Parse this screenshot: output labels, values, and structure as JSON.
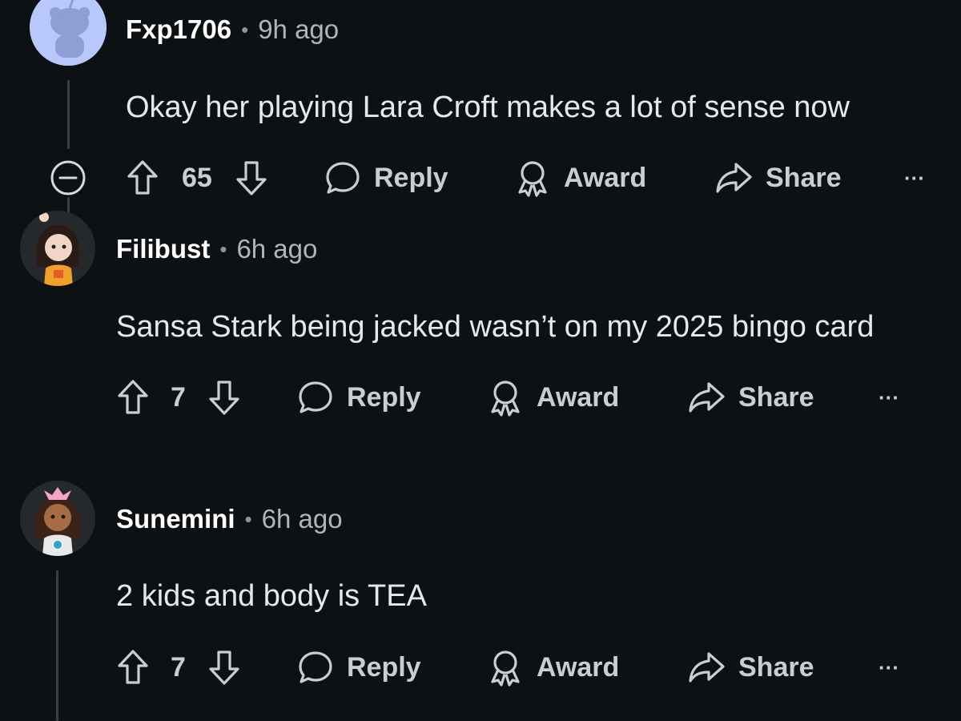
{
  "comments": [
    {
      "username": "Fxp1706",
      "separator": "•",
      "time": "9h ago",
      "body": "Okay her playing Lara Croft makes a lot of sense now",
      "votes": "65",
      "reply": "Reply",
      "award": "Award",
      "share": "Share",
      "more": "···"
    },
    {
      "username": "Filibust",
      "separator": "•",
      "time": "6h ago",
      "body": "Sansa Stark being jacked wasn’t on my 2025 bingo card",
      "votes": "7",
      "reply": "Reply",
      "award": "Award",
      "share": "Share",
      "more": "···"
    },
    {
      "username": "Sunemini",
      "separator": "•",
      "time": "6h ago",
      "body": "2 kids and body is TEA",
      "votes": "7",
      "reply": "Reply",
      "award": "Award",
      "share": "Share",
      "more": "···"
    }
  ],
  "colors": {
    "background": "#0e1113",
    "thread_line": "#3a3f44",
    "text": "#d7dadc"
  }
}
